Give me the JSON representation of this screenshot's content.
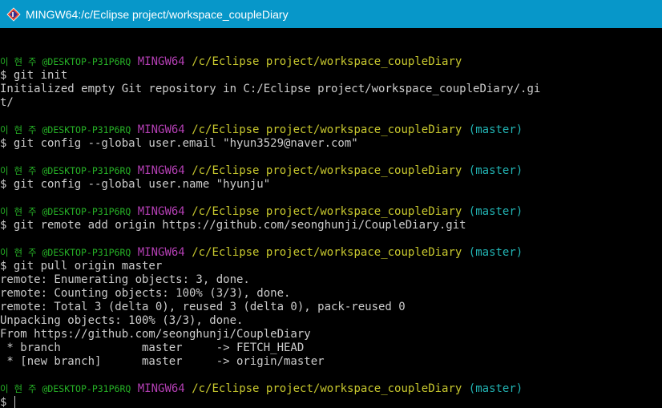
{
  "window": {
    "title": "MINGW64:/c/Eclipse project/workspace_coupleDiary",
    "titlebar_color": "#0797c9"
  },
  "terminal": {
    "colors": {
      "user": "#26b226",
      "mingw": "#b43fb4",
      "path": "#c8c82e",
      "branch": "#22b4b4",
      "text": "#cccccc",
      "background": "#000000"
    },
    "blocks": [
      {
        "prompt": {
          "user": "이 현 주 @DESKTOP-P31P6RQ",
          "mingw": "MINGW64",
          "path": "/c/Eclipse project/workspace_coupleDiary",
          "branch": ""
        },
        "command": "$ git init",
        "output": [
          "Initialized empty Git repository in C:/Eclipse project/workspace_coupleDiary/.gi",
          "t/"
        ]
      },
      {
        "prompt": {
          "user": "이 현 주 @DESKTOP-P31P6RQ",
          "mingw": "MINGW64",
          "path": "/c/Eclipse project/workspace_coupleDiary",
          "branch": "(master)"
        },
        "command": "$ git config --global user.email \"hyun3529@naver.com\"",
        "output": []
      },
      {
        "prompt": {
          "user": "이 현 주 @DESKTOP-P31P6RQ",
          "mingw": "MINGW64",
          "path": "/c/Eclipse project/workspace_coupleDiary",
          "branch": "(master)"
        },
        "command": "$ git config --global user.name \"hyunju\"",
        "output": []
      },
      {
        "prompt": {
          "user": "이 현 주 @DESKTOP-P31P6RQ",
          "mingw": "MINGW64",
          "path": "/c/Eclipse project/workspace_coupleDiary",
          "branch": "(master)"
        },
        "command": "$ git remote add origin https://github.com/seonghunji/CoupleDiary.git",
        "output": []
      },
      {
        "prompt": {
          "user": "이 현 주 @DESKTOP-P31P6RQ",
          "mingw": "MINGW64",
          "path": "/c/Eclipse project/workspace_coupleDiary",
          "branch": "(master)"
        },
        "command": "$ git pull origin master",
        "output": [
          "remote: Enumerating objects: 3, done.",
          "remote: Counting objects: 100% (3/3), done.",
          "remote: Total 3 (delta 0), reused 3 (delta 0), pack-reused 0",
          "Unpacking objects: 100% (3/3), done.",
          "From https://github.com/seonghunji/CoupleDiary",
          " * branch            master     -> FETCH_HEAD",
          " * [new branch]      master     -> origin/master"
        ]
      },
      {
        "prompt": {
          "user": "이 현 주 @DESKTOP-P31P6RQ",
          "mingw": "MINGW64",
          "path": "/c/Eclipse project/workspace_coupleDiary",
          "branch": "(master)"
        },
        "command": "$ ",
        "output": [],
        "active": true
      }
    ]
  }
}
